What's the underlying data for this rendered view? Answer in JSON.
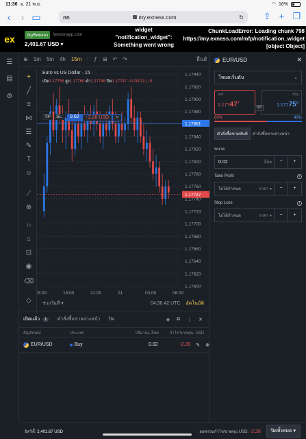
{
  "status": {
    "time": "11:36",
    "date": "อ. 21 พ.ย.",
    "battery": "16%"
  },
  "browser": {
    "aa": "กก",
    "host": "my.exness.com"
  },
  "header": {
    "badge": "บัญชีทดลอง",
    "server": "forexonapp.com",
    "balance": "2,401.67 USD",
    "widget_error": "widget \"notification_widget\": Something went wrong",
    "chunk_error": "ChunkLoadError: Loading chunk 798 https://my.exness.com/mfp/notification_widget [object Object]"
  },
  "chart_toolbar": {
    "timeframes": [
      "1m",
      "5m",
      "4h",
      "15m"
    ],
    "active_tf": "15m",
    "buy_label": "ยืนยั"
  },
  "chart_info": {
    "title": "Euro vs US Dollar · 15 ·",
    "o_label": "เปิด",
    "o": "1.17758",
    "h_label": "สูง",
    "h": "1.17760",
    "l_label": "ต่ำ",
    "l": "1.17746",
    "c_label": "ปิด",
    "c": "1.17747",
    "chg": "−0.00011 (−0.",
    "tp": "TP",
    "sl": "SL",
    "pos_qty": "0.02",
    "pos_pl": "−2.28 USD"
  },
  "chart_data": {
    "type": "candlestick",
    "title": "Euro vs US Dollar · 15",
    "ylim": [
      1.176,
      1.1795
    ],
    "y_ticks": [
      "1.17940",
      "1.17920",
      "1.17900",
      "1.17880",
      "1.17860",
      "1.17840",
      "1.17820",
      "1.17800",
      "1.17780",
      "1.17760",
      "1.17740",
      "1.17720",
      "1.17700",
      "1.17680",
      "1.17660",
      "1.17640",
      "1.17620",
      "1.17600"
    ],
    "x_ticks": [
      "15:00",
      "18:00",
      "21:00",
      "21",
      "03:00",
      "06:00"
    ],
    "position_line": "1.17861",
    "last_price": "1.17747",
    "candles": [
      {
        "o": 1.1772,
        "h": 1.1778,
        "l": 1.1771,
        "c": 1.1776
      },
      {
        "o": 1.1776,
        "h": 1.1784,
        "l": 1.1775,
        "c": 1.1783
      },
      {
        "o": 1.1783,
        "h": 1.1789,
        "l": 1.1781,
        "c": 1.1788
      },
      {
        "o": 1.1788,
        "h": 1.1791,
        "l": 1.1784,
        "c": 1.1785
      },
      {
        "o": 1.1785,
        "h": 1.179,
        "l": 1.1783,
        "c": 1.1789
      },
      {
        "o": 1.1789,
        "h": 1.1792,
        "l": 1.1786,
        "c": 1.1787
      },
      {
        "o": 1.1787,
        "h": 1.1789,
        "l": 1.1783,
        "c": 1.1785
      },
      {
        "o": 1.1785,
        "h": 1.1788,
        "l": 1.1782,
        "c": 1.1787
      },
      {
        "o": 1.1787,
        "h": 1.179,
        "l": 1.1784,
        "c": 1.1785
      },
      {
        "o": 1.1785,
        "h": 1.1787,
        "l": 1.178,
        "c": 1.1782
      },
      {
        "o": 1.1782,
        "h": 1.1787,
        "l": 1.1781,
        "c": 1.1786
      },
      {
        "o": 1.1786,
        "h": 1.1788,
        "l": 1.1783,
        "c": 1.1784
      },
      {
        "o": 1.1784,
        "h": 1.1787,
        "l": 1.1782,
        "c": 1.1786
      },
      {
        "o": 1.1786,
        "h": 1.1789,
        "l": 1.1784,
        "c": 1.1785
      },
      {
        "o": 1.1785,
        "h": 1.1788,
        "l": 1.1783,
        "c": 1.1787
      },
      {
        "o": 1.1787,
        "h": 1.1789,
        "l": 1.1785,
        "c": 1.1786
      },
      {
        "o": 1.1786,
        "h": 1.1789,
        "l": 1.1784,
        "c": 1.1788
      },
      {
        "o": 1.1788,
        "h": 1.179,
        "l": 1.1785,
        "c": 1.1786
      },
      {
        "o": 1.1786,
        "h": 1.1788,
        "l": 1.1783,
        "c": 1.1784
      },
      {
        "o": 1.1784,
        "h": 1.1787,
        "l": 1.1782,
        "c": 1.1786
      },
      {
        "o": 1.1786,
        "h": 1.1788,
        "l": 1.1784,
        "c": 1.1785
      },
      {
        "o": 1.1785,
        "h": 1.1789,
        "l": 1.1784,
        "c": 1.1788
      },
      {
        "o": 1.1788,
        "h": 1.179,
        "l": 1.1785,
        "c": 1.1786
      },
      {
        "o": 1.1786,
        "h": 1.1788,
        "l": 1.1783,
        "c": 1.1784
      },
      {
        "o": 1.1784,
        "h": 1.1787,
        "l": 1.1783,
        "c": 1.1786
      },
      {
        "o": 1.1786,
        "h": 1.1788,
        "l": 1.1784,
        "c": 1.1785
      },
      {
        "o": 1.1785,
        "h": 1.1787,
        "l": 1.1783,
        "c": 1.1786
      },
      {
        "o": 1.1786,
        "h": 1.1791,
        "l": 1.1785,
        "c": 1.179
      },
      {
        "o": 1.179,
        "h": 1.1792,
        "l": 1.1786,
        "c": 1.1787
      },
      {
        "o": 1.1787,
        "h": 1.1789,
        "l": 1.1784,
        "c": 1.1785
      },
      {
        "o": 1.1785,
        "h": 1.1788,
        "l": 1.1783,
        "c": 1.1787
      },
      {
        "o": 1.1787,
        "h": 1.1788,
        "l": 1.1783,
        "c": 1.1784
      },
      {
        "o": 1.1784,
        "h": 1.1786,
        "l": 1.1781,
        "c": 1.1782
      },
      {
        "o": 1.1782,
        "h": 1.1785,
        "l": 1.178,
        "c": 1.1783
      },
      {
        "o": 1.1783,
        "h": 1.1784,
        "l": 1.1779,
        "c": 1.178
      },
      {
        "o": 1.178,
        "h": 1.1782,
        "l": 1.1777,
        "c": 1.1778
      },
      {
        "o": 1.1778,
        "h": 1.1781,
        "l": 1.1776,
        "c": 1.1779
      },
      {
        "o": 1.1779,
        "h": 1.178,
        "l": 1.1775,
        "c": 1.1776
      },
      {
        "o": 1.1776,
        "h": 1.1778,
        "l": 1.1773,
        "c": 1.1774
      },
      {
        "o": 1.1774,
        "h": 1.1777,
        "l": 1.1773,
        "c": 1.1776
      },
      {
        "o": 1.1776,
        "h": 1.1777,
        "l": 1.1774,
        "c": 1.1775
      }
    ]
  },
  "chart_bottom": {
    "range": "ช่วงวันที่",
    "clock": "04:36:42 UTC",
    "auto": "อัตโนมัติ"
  },
  "panel": {
    "symbol": "EUR/USD",
    "mode": "โหมดเริ่มต้น",
    "sell_label": "Sell",
    "sell_pre": "1.177",
    "sell_big": "47",
    "sell_sup": "7",
    "buy_label": "Buy",
    "buy_pre": "1.177",
    "buy_big": "75",
    "buy_sup": "8",
    "spread": "0.8",
    "sell_pct": "60%",
    "buy_pct": "40%",
    "tab_market": "คำสั่งซื้อขายทันที",
    "tab_pending": "คำสั่งซื้อขายล่วงหน้า",
    "volume_label": "ขนาด",
    "volume": "0.02",
    "volume_unit": "ล็อต",
    "tp_label": "Take Profit",
    "tp_value": "ไม่ได้กำหนด",
    "tp_unit": "ราคา",
    "sl_label": "Stop Loss",
    "sl_value": "ไม่ได้กำหนด",
    "sl_unit": "ราคา"
  },
  "positions": {
    "tab_open": "เปิดแล้ว",
    "open_count": "1",
    "tab_pending": "คำสั่งซื้อขายล่วงหน้า",
    "tab_closed": "ปิด",
    "headers": [
      "สัญลักษณ์",
      "ประเภท",
      "ปริมาณ, ล็อต",
      "กำไร/ขาดทุน, USD"
    ],
    "rows": [
      {
        "symbol": "EUR/USD",
        "type": "Buy",
        "volume": "0.02",
        "pl": "-2.28"
      }
    ]
  },
  "footer": {
    "equity_label": "อิควิตี้:",
    "equity": "2,401.67 USD",
    "total_label": "ยอดรวมกำไร/ขาดทุน USD:",
    "total": "-2.28",
    "close_all": "ปิดทั้งหมด"
  }
}
